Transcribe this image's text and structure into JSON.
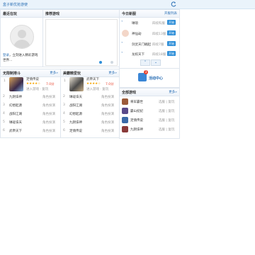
{
  "topbar": {
    "title": "盒子新优抢游使"
  },
  "recent": {
    "title": "最近在玩",
    "hint_link": "登录",
    "hint_text": "，立刻进入精彩游戏世界..."
  },
  "recommend": {
    "title": "推荐游戏"
  },
  "today": {
    "title": "今日新服",
    "more": "开服列表",
    "items": [
      {
        "name": "琳琅",
        "server": "四续科服",
        "btn": "开始"
      },
      {
        "name": "神仙劫",
        "server": "四续13服",
        "btn": "开始"
      },
      {
        "name": "剑灵天门崛起",
        "server": "四续7服",
        "btn": "开始"
      },
      {
        "name": "龙权天下",
        "server": "四续18服",
        "btn": "开始"
      }
    ]
  },
  "activity": {
    "label": "活动中心",
    "badge": "3"
  },
  "left_rank": {
    "title": "无限制排斗",
    "more": "更多»",
    "top": {
      "rank": "1",
      "name": "足情传说",
      "score": "7.0分",
      "stars": "★★★★☆",
      "sub": "进入游戏 · 复玩"
    },
    "rows": [
      {
        "rank": "2",
        "name": "九阴诛神",
        "tag": "角色扮演"
      },
      {
        "rank": "3",
        "name": "幻想起源",
        "tag": "角色扮演"
      },
      {
        "rank": "4",
        "name": "战阳江湖",
        "tag": "角色扮演"
      },
      {
        "rank": "5",
        "name": "琳珑诛天",
        "tag": "角色扮演"
      },
      {
        "rank": "6",
        "name": "武帝天下",
        "tag": "角色扮演"
      }
    ]
  },
  "mid_rank": {
    "title": "美霸精爱玩",
    "more": "更多»",
    "top": {
      "rank": "1",
      "name": "武帝天下",
      "score": "7.0分",
      "stars": "★★★★☆",
      "sub": "进入游戏 · 复玩"
    },
    "rows": [
      {
        "rank": "2",
        "name": "琳珑诛天",
        "tag": "角色扮演"
      },
      {
        "rank": "3",
        "name": "战阳江湖",
        "tag": "角色扮演"
      },
      {
        "rank": "4",
        "name": "幻想起源",
        "tag": "角色扮演"
      },
      {
        "rank": "5",
        "name": "九阴诛神",
        "tag": "角色扮演"
      },
      {
        "rank": "6",
        "name": "足情传说",
        "tag": "角色扮演"
      }
    ]
  },
  "all_games": {
    "title": "全部游戏",
    "more": "更多»",
    "items": [
      {
        "name": "将军霸世",
        "actions": "选服 | 复玩"
      },
      {
        "name": "霸山纪纪",
        "actions": "选服 | 复玩"
      },
      {
        "name": "足情传说",
        "actions": "选服 | 复玩"
      },
      {
        "name": "九阴诛神",
        "actions": "选服 | 复玩"
      }
    ]
  },
  "colors": {
    "accent": "#2f8fd8",
    "link": "#2a6fb5",
    "star": "#f5a400"
  }
}
